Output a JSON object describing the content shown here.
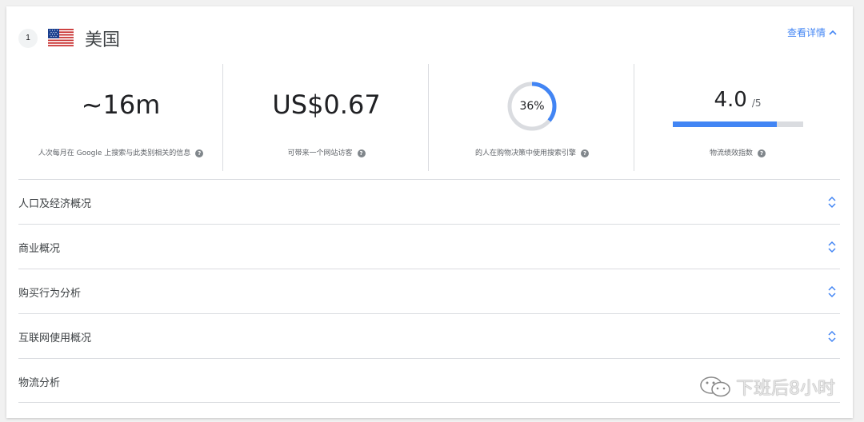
{
  "header": {
    "rank": "1",
    "country": "美国",
    "details_link": "查看详情",
    "flag_icon": "us-flag-icon"
  },
  "metrics": [
    {
      "value": "~16m",
      "label": "人次每月在 Google 上搜索与此类别相关的信息"
    },
    {
      "value": "US$0.67",
      "label": "可带来一个网站访客"
    },
    {
      "value": "36%",
      "percent": 36,
      "label": "的人在购物决策中使用搜索引擎"
    },
    {
      "value": "4.0",
      "max": "/5",
      "fraction": 0.8,
      "label": "物流绩效指数"
    }
  ],
  "sections": [
    {
      "label": "人口及经济概况",
      "icon": "expand-icon"
    },
    {
      "label": "商业概况",
      "icon": "expand-icon"
    },
    {
      "label": "购买行为分析",
      "icon": "expand-icon"
    },
    {
      "label": "互联网使用概况",
      "icon": "expand-icon"
    },
    {
      "label": "物流分析"
    }
  ],
  "watermark": "下班后8小时",
  "colors": {
    "accent": "#4285f4",
    "track": "#dadce0",
    "text": "#202124"
  }
}
